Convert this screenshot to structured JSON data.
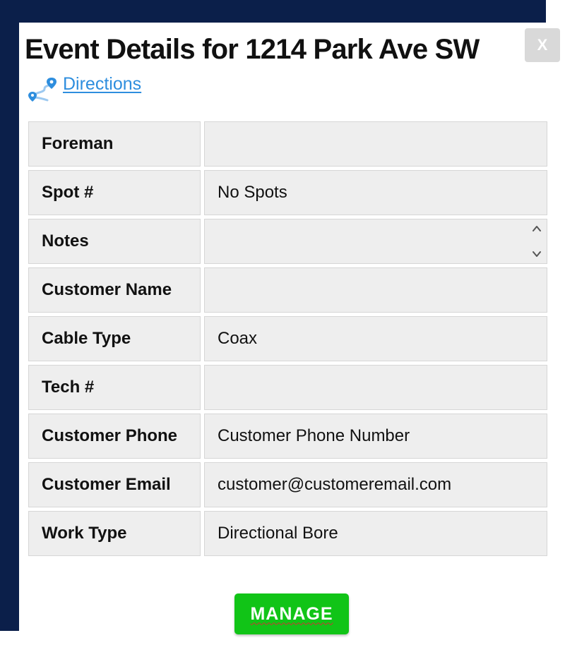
{
  "dialog": {
    "title": "Event Details for 1214 Park Ave SW",
    "close_label": "X",
    "directions_label": "Directions",
    "manage_label": "MANAGE"
  },
  "details": [
    {
      "label": "Foreman",
      "value": ""
    },
    {
      "label": "Spot #",
      "value": "No Spots"
    },
    {
      "label": "Notes",
      "value": ""
    },
    {
      "label": "Customer Name",
      "value": ""
    },
    {
      "label": "Cable Type",
      "value": "Coax"
    },
    {
      "label": "Tech #",
      "value": ""
    },
    {
      "label": "Customer Phone",
      "value": "Customer Phone Number"
    },
    {
      "label": "Customer Email",
      "value": "customer@customeremail.com"
    },
    {
      "label": "Work Type",
      "value": "Directional Bore"
    }
  ],
  "colors": {
    "backdrop": "#0b1f4a",
    "link": "#2e8ede",
    "manage_button": "#11c417",
    "close_button": "#d9d9d9",
    "cell_background": "#eeeeee"
  },
  "icons": {
    "directions": "route-pin-icon",
    "notes_scroll_up": "chevron-up-icon",
    "notes_scroll_down": "chevron-down-icon"
  }
}
